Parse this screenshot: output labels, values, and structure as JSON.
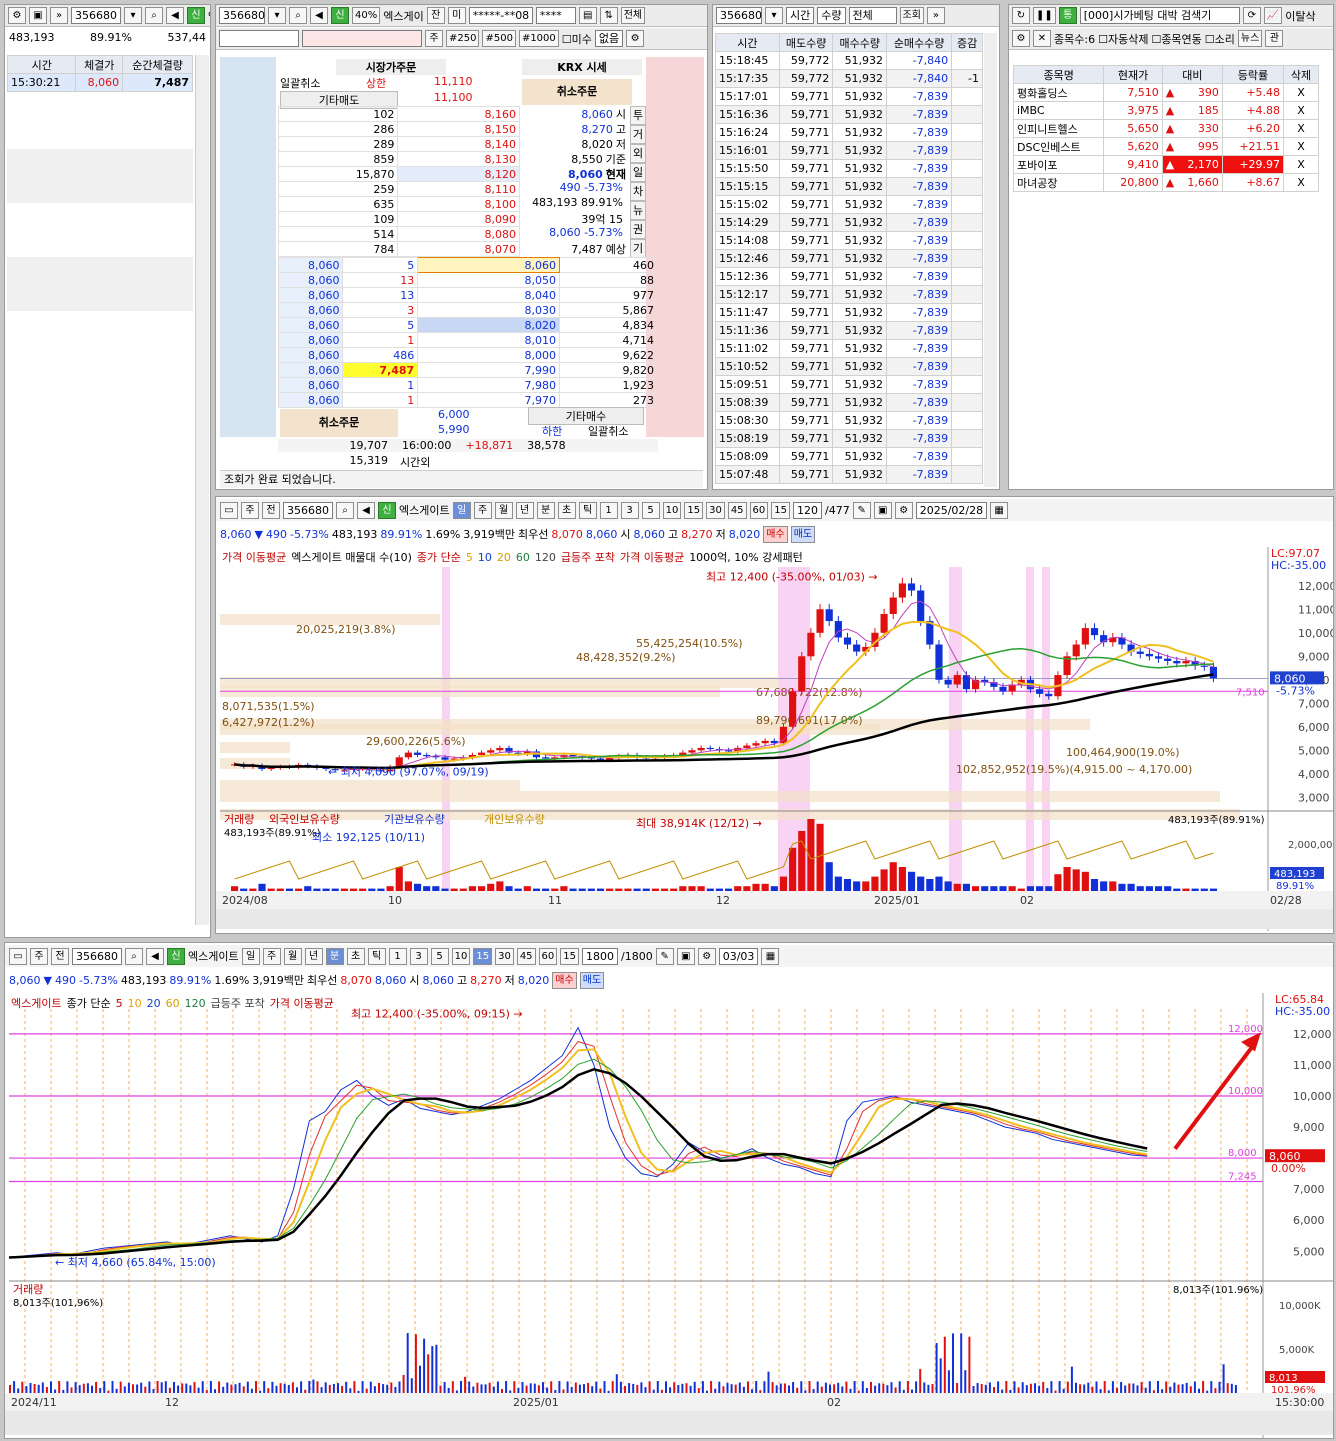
{
  "colors": {
    "up": "#e01010",
    "down": "#1030d8",
    "magenta": "#e040e0",
    "ma5": "#f0c020",
    "ma20": "#2aa030",
    "ma120": "#000000"
  },
  "ticks": {
    "header": {
      "code": "356680",
      "badge": "신",
      "name": "엑"
    },
    "summary": {
      "volume": "483,193",
      "ratio": "89.91%",
      "prev": "537,44"
    },
    "cols": [
      "시간",
      "체결가",
      "순간체결량"
    ],
    "rows": [
      {
        "time": "15:30:21",
        "price": "8,060",
        "qty": "7,487"
      }
    ]
  },
  "order": {
    "code": "356680",
    "pct": "40%",
    "name": "엑스게이",
    "tabs": [
      "잔",
      "미"
    ],
    "account": "*****-**08",
    "pw": "****",
    "all_btn": "전체",
    "row2": [
      "주",
      "#250",
      "#500",
      "#1000",
      "미수",
      "없음"
    ],
    "market_order": "시장가주문",
    "krx": "KRX 시세",
    "bulk_cancel": "일괄취소",
    "upper": "상한",
    "upper_price": "11,110",
    "upper_price2": "11,100",
    "other_sell": "기타매도",
    "cancel": "취소주문",
    "side_tabs": [
      "투",
      "거",
      "외",
      "일",
      "차",
      "뉴",
      "권",
      "기"
    ],
    "asks": [
      {
        "qty": "102",
        "price": "8,160"
      },
      {
        "qty": "286",
        "price": "8,150"
      },
      {
        "qty": "289",
        "price": "8,140"
      },
      {
        "qty": "859",
        "price": "8,130"
      },
      {
        "qty": "15,870",
        "price": "8,120"
      },
      {
        "qty": "259",
        "price": "8,110"
      },
      {
        "qty": "635",
        "price": "8,100"
      },
      {
        "qty": "109",
        "price": "8,090"
      },
      {
        "qty": "514",
        "price": "8,080"
      },
      {
        "qty": "784",
        "price": "8,070"
      }
    ],
    "info": [
      {
        "v": "8,060",
        "k": "시"
      },
      {
        "v": "8,270",
        "k": "고"
      },
      {
        "v": "8,020",
        "k": "저"
      },
      {
        "v": "8,550",
        "k": "기준"
      },
      {
        "v": "8,060",
        "k": "현재"
      },
      {
        "v": "490  -5.73%",
        "k": ""
      },
      {
        "v": "483,193  89.91%",
        "k": ""
      },
      {
        "v": "39억  15",
        "k": ""
      },
      {
        "v": "8,060  -5.73%",
        "k": ""
      },
      {
        "v": "7,487",
        "k": "예상"
      }
    ],
    "bids": [
      {
        "trade": "8,060",
        "tq": "5",
        "price": "8,060",
        "qty": "460"
      },
      {
        "trade": "8,060",
        "tq": "13",
        "price": "8,050",
        "qty": "88"
      },
      {
        "trade": "8,060",
        "tq": "13",
        "price": "8,040",
        "qty": "977"
      },
      {
        "trade": "8,060",
        "tq": "3",
        "price": "8,030",
        "qty": "5,867"
      },
      {
        "trade": "8,060",
        "tq": "5",
        "price": "8,020",
        "qty": "4,834"
      },
      {
        "trade": "8,060",
        "tq": "1",
        "price": "8,010",
        "qty": "4,714"
      },
      {
        "trade": "8,060",
        "tq": "486",
        "price": "8,000",
        "qty": "9,622"
      },
      {
        "trade": "8,060",
        "tq": "7,487",
        "price": "7,990",
        "qty": "9,820"
      },
      {
        "trade": "8,060",
        "tq": "1",
        "price": "7,980",
        "qty": "1,923"
      },
      {
        "trade": "8,060",
        "tq": "1",
        "price": "7,970",
        "qty": "273"
      }
    ],
    "bottom": {
      "p1": "6,000",
      "p2": "5,990",
      "other_buy": "기타매수",
      "lower": "하한",
      "bulk_cancel2": "일괄취소",
      "total_ask": "19,707",
      "time": "16:00:00",
      "diff": "+18,871",
      "total_bid": "38,578",
      "after": "15,319",
      "after_label": "시간외",
      "status": "조회가 완료 되었습니다."
    }
  },
  "trades": {
    "code": "356680",
    "opt1": "시간",
    "opt2": "수량",
    "opt3": "전체",
    "btn": "조회",
    "cols": [
      "시간",
      "매도수량",
      "매수수량",
      "순매수수량",
      "증감"
    ],
    "rows": [
      [
        "15:18:45",
        "59,772",
        "51,932",
        "-7,840",
        ""
      ],
      [
        "15:17:35",
        "59,772",
        "51,932",
        "-7,840",
        "-1"
      ],
      [
        "15:17:01",
        "59,771",
        "51,932",
        "-7,839",
        ""
      ],
      [
        "15:16:36",
        "59,771",
        "51,932",
        "-7,839",
        ""
      ],
      [
        "15:16:24",
        "59,771",
        "51,932",
        "-7,839",
        ""
      ],
      [
        "15:16:01",
        "59,771",
        "51,932",
        "-7,839",
        ""
      ],
      [
        "15:15:50",
        "59,771",
        "51,932",
        "-7,839",
        ""
      ],
      [
        "15:15:15",
        "59,771",
        "51,932",
        "-7,839",
        ""
      ],
      [
        "15:15:02",
        "59,771",
        "51,932",
        "-7,839",
        ""
      ],
      [
        "15:14:29",
        "59,771",
        "51,932",
        "-7,839",
        ""
      ],
      [
        "15:14:08",
        "59,771",
        "51,932",
        "-7,839",
        ""
      ],
      [
        "15:12:46",
        "59,771",
        "51,932",
        "-7,839",
        ""
      ],
      [
        "15:12:36",
        "59,771",
        "51,932",
        "-7,839",
        ""
      ],
      [
        "15:12:17",
        "59,771",
        "51,932",
        "-7,839",
        ""
      ],
      [
        "15:11:47",
        "59,771",
        "51,932",
        "-7,839",
        ""
      ],
      [
        "15:11:36",
        "59,771",
        "51,932",
        "-7,839",
        ""
      ],
      [
        "15:11:02",
        "59,771",
        "51,932",
        "-7,839",
        ""
      ],
      [
        "15:10:52",
        "59,771",
        "51,932",
        "-7,839",
        ""
      ],
      [
        "15:09:51",
        "59,771",
        "51,932",
        "-7,839",
        ""
      ],
      [
        "15:08:39",
        "59,771",
        "51,932",
        "-7,839",
        ""
      ],
      [
        "15:08:30",
        "59,771",
        "51,932",
        "-7,839",
        ""
      ],
      [
        "15:08:19",
        "59,771",
        "51,932",
        "-7,839",
        ""
      ],
      [
        "15:08:09",
        "59,771",
        "51,932",
        "-7,839",
        ""
      ],
      [
        "15:07:48",
        "59,771",
        "51,932",
        "-7,839",
        ""
      ]
    ]
  },
  "scan": {
    "title": "[000]시가베팅 대박 검색기",
    "extra": "이탈삭",
    "count_label": "종목수:6",
    "opts": [
      "자동삭제",
      "종목연동",
      "소리",
      "뉴스",
      "관"
    ],
    "cols": [
      "종목명",
      "현재가",
      "대비",
      "등락률",
      "삭제"
    ],
    "rows": [
      {
        "name": "평화홀딩스",
        "price": "7,510",
        "diff": "390",
        "rate": "+5.48",
        "del": "X"
      },
      {
        "name": "iMBC",
        "price": "3,975",
        "diff": "185",
        "rate": "+4.88",
        "del": "X"
      },
      {
        "name": "인피니트헬스",
        "price": "5,650",
        "diff": "330",
        "rate": "+6.20",
        "del": "X"
      },
      {
        "name": "DSC인베스트",
        "price": "5,620",
        "diff": "995",
        "rate": "+21.51",
        "del": "X"
      },
      {
        "name": "포바이포",
        "price": "9,410",
        "diff": "2,170",
        "rate": "+29.97",
        "del": "X"
      },
      {
        "name": "마녀공장",
        "price": "20,800",
        "diff": "1,660",
        "rate": "+8.67",
        "del": "X"
      }
    ]
  },
  "daily": {
    "code": "356680",
    "name": "엑스게이트",
    "periods": [
      "일",
      "주",
      "월",
      "년",
      "분",
      "초",
      "틱"
    ],
    "nums": [
      "1",
      "3",
      "5",
      "10",
      "15",
      "30",
      "45",
      "60",
      "15"
    ],
    "count": "120",
    "total": "/477",
    "date": "2025/02/28",
    "buy": "매수",
    "sell": "매도",
    "quote": {
      "price": "8,060",
      "chg": "490",
      "pct": "-5.73%",
      "vol": "483,193",
      "vr": "89.91%",
      "turn": "1.69%",
      "amt": "3,919백만",
      "best": "최우선",
      "b1": "8,070",
      "b2": "8,060",
      "open_l": "시",
      "open": "8,060",
      "high_l": "고",
      "high": "8,270",
      "low_l": "저",
      "low": "8,020"
    },
    "legend": [
      "가격 이동평균",
      "엑스게이트 매물대 수(10)",
      "종가 단순",
      "5",
      "10",
      "20",
      "60",
      "120",
      "급등주 포착",
      "가격 이동평균",
      "1000억, 10% 강세패턴"
    ],
    "vol_legend": [
      "거래량",
      "외국인보유수량",
      "기관보유수량",
      "개인보유수량"
    ],
    "lc": "LC:97.07",
    "hc": "HC:-35.00",
    "xlabels": [
      "2024/08",
      "10",
      "11",
      "12",
      "2025/01",
      "02",
      "02/28"
    ],
    "yticks": [
      "12,000",
      "11,000",
      "10,000",
      "9,000",
      "8,000",
      "7,000",
      "6,000",
      "5,000",
      "4,000",
      "3,000"
    ],
    "vticks": [
      "2,000,000"
    ],
    "ann": {
      "high": "최고 12,400 (-35.00%, 01/03) →",
      "low": "← 최저 4,090 (97.07%, 09/19)",
      "vmax": "최대 38,914K (12/12) →",
      "vmin": "최소 192,125 (10/11)",
      "vol_now": "483,193주(89.91%)",
      "vol_label": "483,193",
      "vol_pct": "89.91%",
      "price_tag": "8,060",
      "pct_tag": "-5.73%",
      "line7510": "7,510"
    },
    "profile": [
      "20,025,219(3.8%)",
      "55,425,254(10.5%)",
      "48,428,352(9.2%)",
      "89,796,691(17.0%)",
      "67,680,722(12.8%)",
      "8,071,535(1.5%)",
      "6,427,972(1.2%)",
      "29,600,226(5.6%)",
      "100,464,900(19.0%)",
      "102,852,952(19.5%)(4,915.00 ~ 4,170.00)"
    ]
  },
  "intraday": {
    "code": "356680",
    "name": "엑스게이트",
    "periods": [
      "일",
      "주",
      "월",
      "년",
      "분",
      "초",
      "틱"
    ],
    "nums": [
      "1",
      "3",
      "5",
      "10",
      "15",
      "30",
      "45",
      "60",
      "15"
    ],
    "count": "1800",
    "total": "/1800",
    "date": "03/03",
    "buy": "매수",
    "sell": "매도",
    "quote": {
      "price": "8,060",
      "chg": "490",
      "pct": "-5.73%",
      "vol": "483,193",
      "vr": "89.91%",
      "turn": "1.69%",
      "amt": "3,919백만",
      "best": "최우선",
      "b1": "8,070",
      "b2": "8,060",
      "open_l": "시",
      "open": "8,060",
      "high_l": "고",
      "high": "8,270",
      "low_l": "저",
      "low": "8,020"
    },
    "legend": [
      "엑스게이트",
      "종가 단순",
      "5",
      "10",
      "20",
      "60",
      "120",
      "급등주 포착",
      "가격 이동평균"
    ],
    "lc": "LC:65.84",
    "hc": "HC:-35.00",
    "xlabels": [
      "2024/11",
      "12",
      "2025/01",
      "02",
      "15:30:00"
    ],
    "yticks": [
      "12,000",
      "11,000",
      "10,000",
      "9,000",
      "8,000",
      "7,000",
      "6,000",
      "5,000"
    ],
    "hlines": [
      "12,000",
      "10,000",
      "8,000",
      "7,245"
    ],
    "vticks": [
      "10,000K",
      "5,000K"
    ],
    "ann": {
      "high": "최고 12,400 (-35.00%, 09:15) →",
      "low": "← 최저 4,660 (65.84%, 15:00)",
      "vol_label": "거래량",
      "vol_now": "8,013주(101.96%)",
      "vol_now2": "8,013주(101,96%)",
      "price_tag": "8,060",
      "pct_tag": "0.00%",
      "vol_tag": "8,013",
      "vol_pct": "101.96%"
    }
  }
}
